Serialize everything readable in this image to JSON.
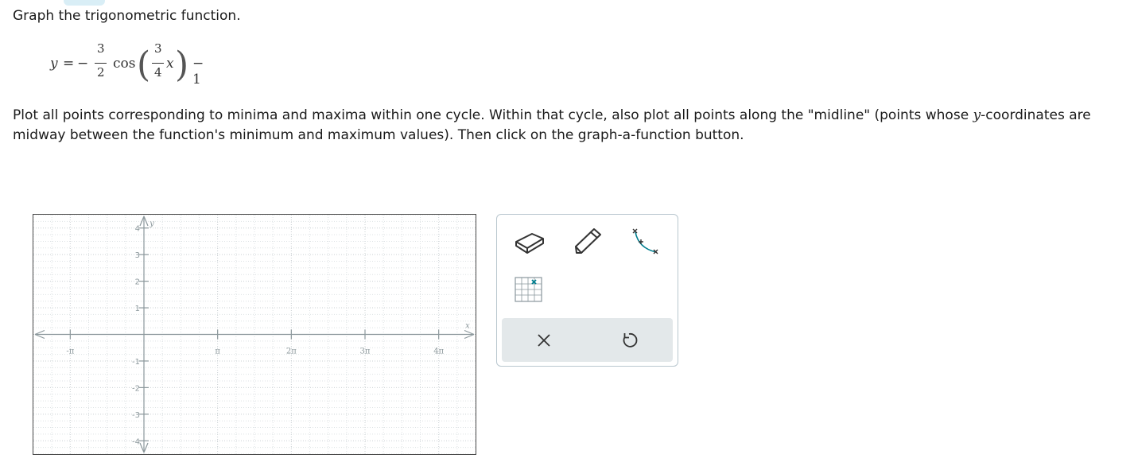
{
  "instruction": "Graph the trigonometric function.",
  "equation": {
    "lhs": "y",
    "equals": "=",
    "sign": "−",
    "amp_num": "3",
    "amp_den": "2",
    "func": "cos",
    "freq_num": "3",
    "freq_den": "4",
    "var": "x",
    "shift": "− 1"
  },
  "prompt": {
    "part1": "Plot all points corresponding to minima and maxima within one cycle. Within that cycle, also plot all points along the \"midline\" (points whose ",
    "yvar": "y",
    "part2": "-coordinates are midway between the function's minimum and maximum values). Then click on the graph-a-function button."
  },
  "graph": {
    "x_axis_label": "x",
    "y_axis_label": "y",
    "x_ticks": [
      {
        "value": -1,
        "label": "-π"
      },
      {
        "value": 1,
        "label": "π"
      },
      {
        "value": 2,
        "label": "2π"
      },
      {
        "value": 3,
        "label": "3π"
      },
      {
        "value": 4,
        "label": "4π"
      }
    ],
    "y_ticks": [
      {
        "value": 4,
        "label": "4"
      },
      {
        "value": 3,
        "label": "3"
      },
      {
        "value": 2,
        "label": "2"
      },
      {
        "value": 1,
        "label": "1"
      },
      {
        "value": -1,
        "label": "-1"
      },
      {
        "value": -2,
        "label": "-2"
      },
      {
        "value": -3,
        "label": "-3"
      },
      {
        "value": -4,
        "label": "-4"
      }
    ],
    "x_range_pi": [
      -1.5,
      4.5
    ],
    "y_range": [
      -4.5,
      4.5
    ],
    "minor_grid_per_unit": 4,
    "grid": true
  },
  "toolbar": {
    "tools": [
      {
        "name": "eraser-tool",
        "icon": "eraser-icon"
      },
      {
        "name": "pencil-tool",
        "icon": "pencil-icon"
      },
      {
        "name": "graph-a-function-tool",
        "icon": "curve-icon"
      },
      {
        "name": "grid-point-tool",
        "icon": "grid-icon"
      }
    ],
    "actions": [
      {
        "name": "clear-button",
        "icon": "close-icon"
      },
      {
        "name": "undo-button",
        "icon": "undo-icon"
      }
    ],
    "accent_color": "#007e8f"
  }
}
